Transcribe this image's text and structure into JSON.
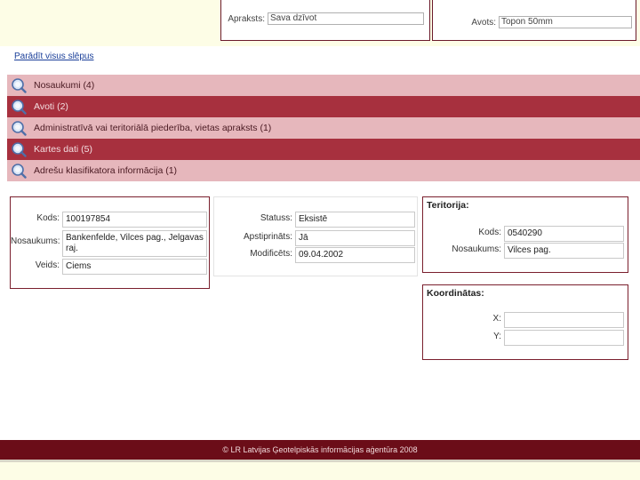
{
  "top_panels": {
    "left": {
      "label": "Apraksts:",
      "value": "Sava dzīvot"
    },
    "right": {
      "label": "Avots:",
      "value": "Topon 50mm"
    }
  },
  "show_all_link": "Parādīt visus slēpus",
  "sections": [
    {
      "label": "Nosaukumi (4)",
      "style": "light",
      "icon": "magnifier-icon"
    },
    {
      "label": "Avoti (2)",
      "style": "dark",
      "icon": "magnifier-icon"
    },
    {
      "label": "Administratīvā vai teritoriālā piederība, vietas apraksts (1)",
      "style": "light",
      "icon": "magnifier-icon"
    },
    {
      "label": "Kartes dati (5)",
      "style": "dark",
      "icon": "magnifier-icon"
    },
    {
      "label": "Adrešu klasifikatora informācija (1)",
      "style": "light",
      "icon": "magnifier-icon"
    }
  ],
  "details": {
    "kods_label": "Kods:",
    "kods_value": "100197854",
    "nosaukums_label": "Nosaukums:",
    "nosaukums_value": "Bankenfelde, Vilces pag., Jelgavas raj.",
    "veids_label": "Veids:",
    "veids_value": "Ciems"
  },
  "status": {
    "statuss_label": "Statuss:",
    "statuss_value": "Eksistē",
    "apstiprinats_label": "Apstiprināts:",
    "apstiprinats_value": "Jā",
    "modificets_label": "Modificēts:",
    "modificets_value": "09.04.2002"
  },
  "territory": {
    "title": "Teritorija:",
    "kods_label": "Kods:",
    "kods_value": "0540290",
    "nosaukums_label": "Nosaukums:",
    "nosaukums_value": "Vilces pag."
  },
  "coordinates": {
    "title": "Koordinātas:",
    "x_label": "X:",
    "x_value": "",
    "y_label": "Y:",
    "y_value": ""
  },
  "footer": "© LR Latvijas Ģeotelpiskās informācijas aģentūra 2008",
  "colors": {
    "section_light": "#e6b7bc",
    "section_dark": "#a7303e",
    "footer": "#6b0d18",
    "border": "#7a1f2d"
  }
}
